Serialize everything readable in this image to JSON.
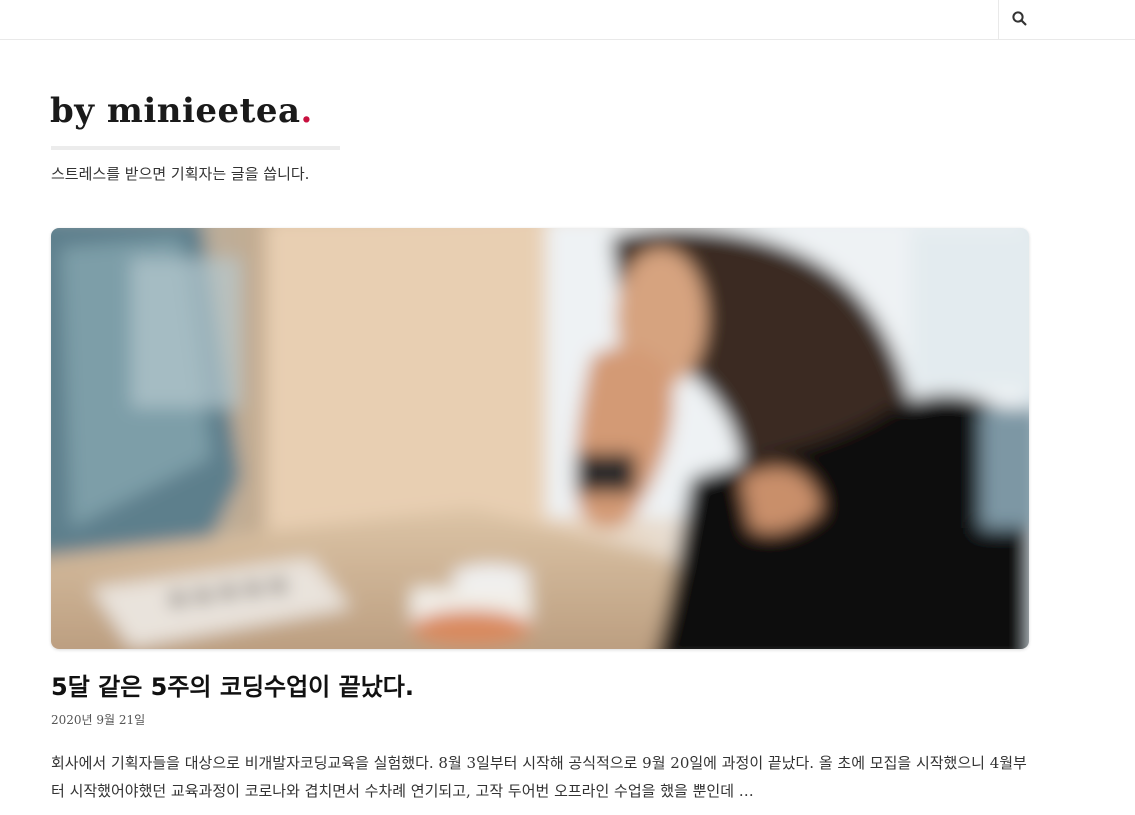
{
  "header": {
    "search_icon": "search-icon"
  },
  "site": {
    "title": "by minieetea",
    "title_dot": ".",
    "tagline": "스트레스를 받으면 기획자는 글을 씁니다.",
    "accent_color": "#c8103f"
  },
  "post": {
    "title": "5달 같은 5주의 코딩수업이 끝났다.",
    "date": "2020년 9월 21일",
    "excerpt": "회사에서 기획자들을 대상으로 비개발자코딩교육을 실험했다. 8월 3일부터 시작해 공식적으로 9월 20일에 과정이 끝났다. 올 초에 모집을 시작했으니 4월부터 시작했어야했던 교육과정이 코로나와 겹치면서 수차례 연기되고, 고작 두어번 오프라인 수업을 했을 뿐인데 …"
  }
}
